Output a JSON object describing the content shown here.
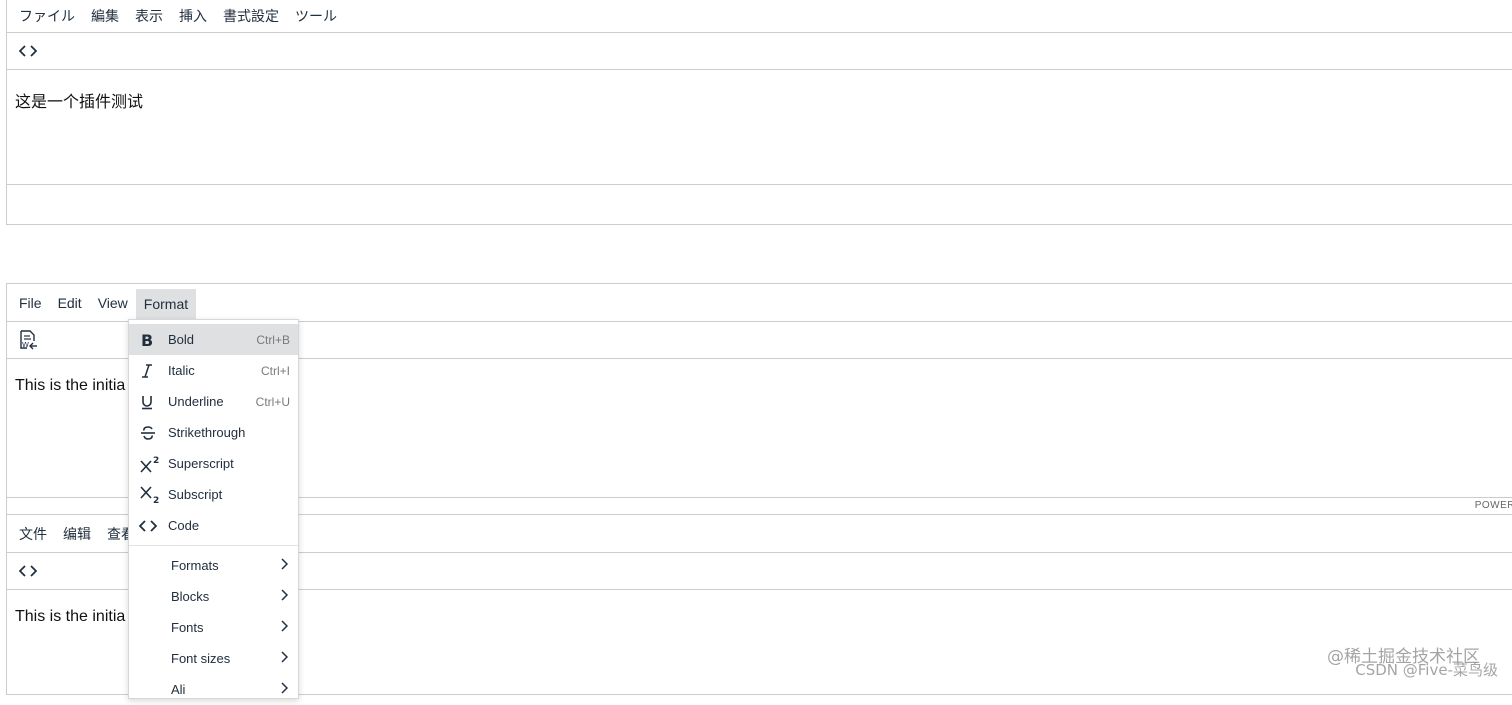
{
  "editor1": {
    "menus": [
      "ファイル",
      "編集",
      "表示",
      "挿入",
      "書式設定",
      "ツール"
    ],
    "toolbar_icon": "code-icon",
    "content": "这是一个插件测试"
  },
  "editor2": {
    "menus": [
      "File",
      "Edit",
      "View",
      "Format"
    ],
    "active_menu": "Format",
    "toolbar_icon": "word-document-icon",
    "content": "This is the initia",
    "status": "POWER"
  },
  "editor3": {
    "menus": [
      "文件",
      "编辑",
      "查看"
    ],
    "toolbar_icon": "code-icon",
    "content": "This is the initia"
  },
  "format_menu": {
    "items": [
      {
        "icon": "bold-icon",
        "label": "Bold",
        "shortcut": "Ctrl+B"
      },
      {
        "icon": "italic-icon",
        "label": "Italic",
        "shortcut": "Ctrl+I"
      },
      {
        "icon": "underline-icon",
        "label": "Underline",
        "shortcut": "Ctrl+U"
      },
      {
        "icon": "strikethrough-icon",
        "label": "Strikethrough",
        "shortcut": ""
      },
      {
        "icon": "superscript-icon",
        "label": "Superscript",
        "shortcut": ""
      },
      {
        "icon": "subscript-icon",
        "label": "Subscript",
        "shortcut": ""
      },
      {
        "icon": "code-icon",
        "label": "Code",
        "shortcut": ""
      }
    ],
    "submenus": [
      "Formats",
      "Blocks",
      "Fonts",
      "Font sizes",
      "Ali"
    ]
  },
  "watermark": {
    "line1": "@稀土掘金技术社区",
    "line2": "CSDN @Five-菜鸟级"
  },
  "colors": {
    "border": "#cccccc",
    "menu_active_bg": "#dee0e2",
    "text": "#222f3e"
  }
}
